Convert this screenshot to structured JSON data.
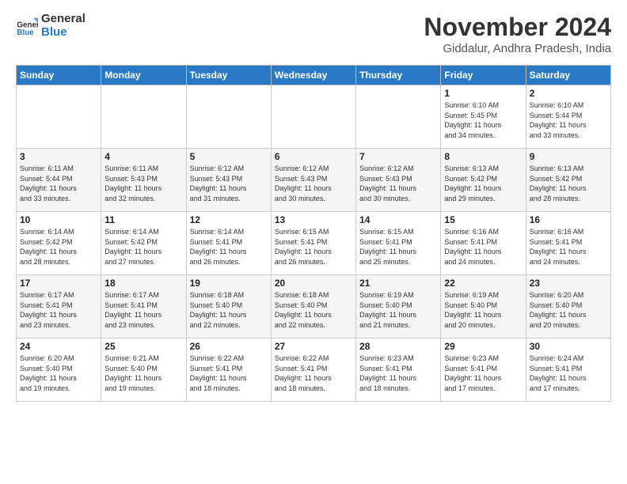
{
  "logo": {
    "line1": "General",
    "line2": "Blue"
  },
  "title": "November 2024",
  "subtitle": "Giddalur, Andhra Pradesh, India",
  "headers": [
    "Sunday",
    "Monday",
    "Tuesday",
    "Wednesday",
    "Thursday",
    "Friday",
    "Saturday"
  ],
  "weeks": [
    [
      {
        "day": "",
        "info": ""
      },
      {
        "day": "",
        "info": ""
      },
      {
        "day": "",
        "info": ""
      },
      {
        "day": "",
        "info": ""
      },
      {
        "day": "",
        "info": ""
      },
      {
        "day": "1",
        "info": "Sunrise: 6:10 AM\nSunset: 5:45 PM\nDaylight: 11 hours\nand 34 minutes."
      },
      {
        "day": "2",
        "info": "Sunrise: 6:10 AM\nSunset: 5:44 PM\nDaylight: 11 hours\nand 33 minutes."
      }
    ],
    [
      {
        "day": "3",
        "info": "Sunrise: 6:11 AM\nSunset: 5:44 PM\nDaylight: 11 hours\nand 33 minutes."
      },
      {
        "day": "4",
        "info": "Sunrise: 6:11 AM\nSunset: 5:43 PM\nDaylight: 11 hours\nand 32 minutes."
      },
      {
        "day": "5",
        "info": "Sunrise: 6:12 AM\nSunset: 5:43 PM\nDaylight: 11 hours\nand 31 minutes."
      },
      {
        "day": "6",
        "info": "Sunrise: 6:12 AM\nSunset: 5:43 PM\nDaylight: 11 hours\nand 30 minutes."
      },
      {
        "day": "7",
        "info": "Sunrise: 6:12 AM\nSunset: 5:43 PM\nDaylight: 11 hours\nand 30 minutes."
      },
      {
        "day": "8",
        "info": "Sunrise: 6:13 AM\nSunset: 5:42 PM\nDaylight: 11 hours\nand 29 minutes."
      },
      {
        "day": "9",
        "info": "Sunrise: 6:13 AM\nSunset: 5:42 PM\nDaylight: 11 hours\nand 28 minutes."
      }
    ],
    [
      {
        "day": "10",
        "info": "Sunrise: 6:14 AM\nSunset: 5:42 PM\nDaylight: 11 hours\nand 28 minutes."
      },
      {
        "day": "11",
        "info": "Sunrise: 6:14 AM\nSunset: 5:42 PM\nDaylight: 11 hours\nand 27 minutes."
      },
      {
        "day": "12",
        "info": "Sunrise: 6:14 AM\nSunset: 5:41 PM\nDaylight: 11 hours\nand 26 minutes."
      },
      {
        "day": "13",
        "info": "Sunrise: 6:15 AM\nSunset: 5:41 PM\nDaylight: 11 hours\nand 26 minutes."
      },
      {
        "day": "14",
        "info": "Sunrise: 6:15 AM\nSunset: 5:41 PM\nDaylight: 11 hours\nand 25 minutes."
      },
      {
        "day": "15",
        "info": "Sunrise: 6:16 AM\nSunset: 5:41 PM\nDaylight: 11 hours\nand 24 minutes."
      },
      {
        "day": "16",
        "info": "Sunrise: 6:16 AM\nSunset: 5:41 PM\nDaylight: 11 hours\nand 24 minutes."
      }
    ],
    [
      {
        "day": "17",
        "info": "Sunrise: 6:17 AM\nSunset: 5:41 PM\nDaylight: 11 hours\nand 23 minutes."
      },
      {
        "day": "18",
        "info": "Sunrise: 6:17 AM\nSunset: 5:41 PM\nDaylight: 11 hours\nand 23 minutes."
      },
      {
        "day": "19",
        "info": "Sunrise: 6:18 AM\nSunset: 5:40 PM\nDaylight: 11 hours\nand 22 minutes."
      },
      {
        "day": "20",
        "info": "Sunrise: 6:18 AM\nSunset: 5:40 PM\nDaylight: 11 hours\nand 22 minutes."
      },
      {
        "day": "21",
        "info": "Sunrise: 6:19 AM\nSunset: 5:40 PM\nDaylight: 11 hours\nand 21 minutes."
      },
      {
        "day": "22",
        "info": "Sunrise: 6:19 AM\nSunset: 5:40 PM\nDaylight: 11 hours\nand 20 minutes."
      },
      {
        "day": "23",
        "info": "Sunrise: 6:20 AM\nSunset: 5:40 PM\nDaylight: 11 hours\nand 20 minutes."
      }
    ],
    [
      {
        "day": "24",
        "info": "Sunrise: 6:20 AM\nSunset: 5:40 PM\nDaylight: 11 hours\nand 19 minutes."
      },
      {
        "day": "25",
        "info": "Sunrise: 6:21 AM\nSunset: 5:40 PM\nDaylight: 11 hours\nand 19 minutes."
      },
      {
        "day": "26",
        "info": "Sunrise: 6:22 AM\nSunset: 5:41 PM\nDaylight: 11 hours\nand 18 minutes."
      },
      {
        "day": "27",
        "info": "Sunrise: 6:22 AM\nSunset: 5:41 PM\nDaylight: 11 hours\nand 18 minutes."
      },
      {
        "day": "28",
        "info": "Sunrise: 6:23 AM\nSunset: 5:41 PM\nDaylight: 11 hours\nand 18 minutes."
      },
      {
        "day": "29",
        "info": "Sunrise: 6:23 AM\nSunset: 5:41 PM\nDaylight: 11 hours\nand 17 minutes."
      },
      {
        "day": "30",
        "info": "Sunrise: 6:24 AM\nSunset: 5:41 PM\nDaylight: 11 hours\nand 17 minutes."
      }
    ]
  ]
}
